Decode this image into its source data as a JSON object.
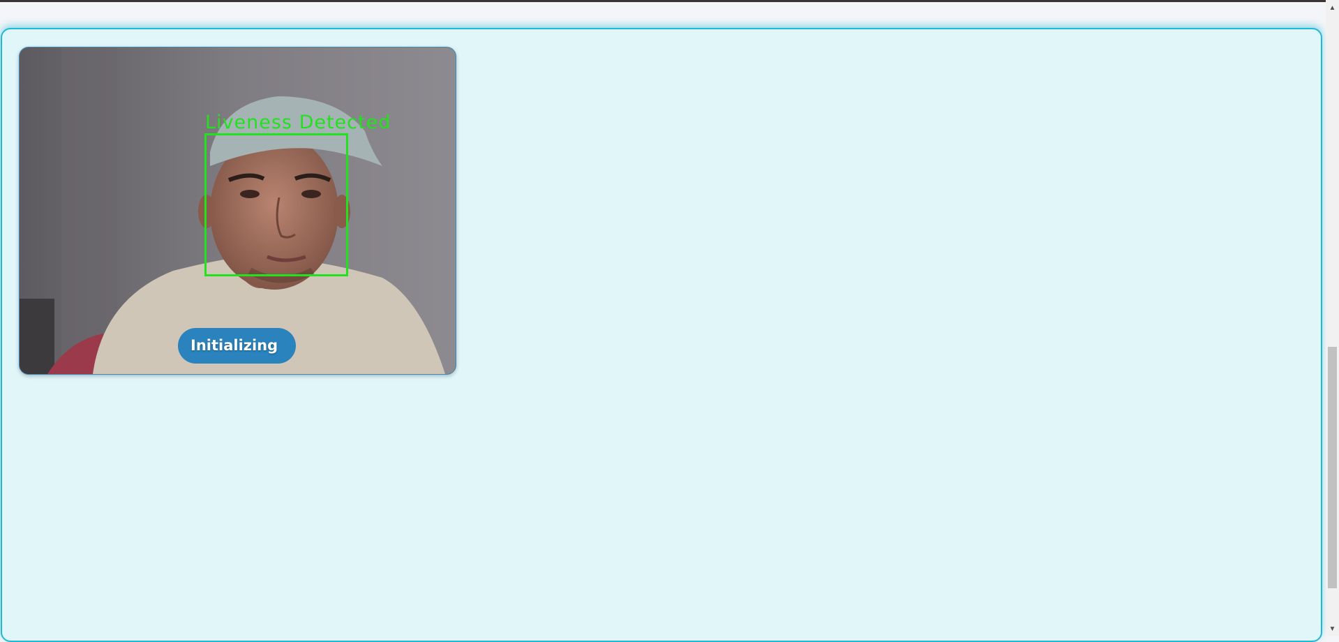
{
  "camera": {
    "overlay_label": "Liveness Detected",
    "status_label": "Initializing"
  },
  "scrollbar": {
    "up_arrow": "▲",
    "down_arrow": "▼"
  },
  "colors": {
    "panel_background": "#e0f6f9",
    "panel_border": "#1fb8d6",
    "detection_green": "#22e21e",
    "status_pill": "#2a83bd"
  },
  "icons": {
    "scroll_up": "triangle-up-icon",
    "scroll_down": "triangle-down-icon"
  }
}
